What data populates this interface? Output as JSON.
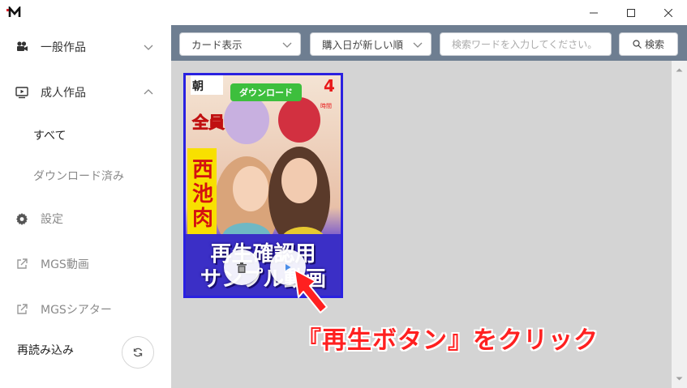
{
  "titlebar": {
    "logo_text": "M",
    "minimize_icon": "minimize-icon",
    "maximize_icon": "maximize-icon",
    "close_icon": "close-icon"
  },
  "sidebar": {
    "general": {
      "label": "一般作品",
      "icon": "video-camera-icon",
      "expanded": false
    },
    "adult": {
      "label": "成人作品",
      "icon": "monitor-play-icon",
      "expanded": true
    },
    "sub_all": "すべて",
    "sub_downloaded": "ダウンロード済み",
    "settings": {
      "label": "設定",
      "icon": "gear-icon"
    },
    "mgs_video": {
      "label": "MGS動画",
      "icon": "external-link-icon"
    },
    "mgs_theater": {
      "label": "MGSシアター",
      "icon": "external-link-icon"
    },
    "reload": {
      "label": "再読み込み",
      "icon": "refresh-icon"
    }
  },
  "toolbar": {
    "view_select": "カード表示",
    "sort_select": "購入日が新しい順",
    "search_placeholder": "検索ワードを入力してください。",
    "search_button": "検索"
  },
  "card": {
    "download_label": "ダウンロード",
    "title": "再生確認用\nサンプル動画",
    "delete_icon": "trash-icon",
    "play_icon": "play-icon"
  },
  "annotation": {
    "text": "『再生ボタン』をクリック",
    "color": "#ff2020"
  },
  "colors": {
    "toolbar_bg": "#6e7e91",
    "content_bg": "#d4d4d4",
    "card_border": "#2a21e0",
    "download_green": "#3dbf3d"
  }
}
